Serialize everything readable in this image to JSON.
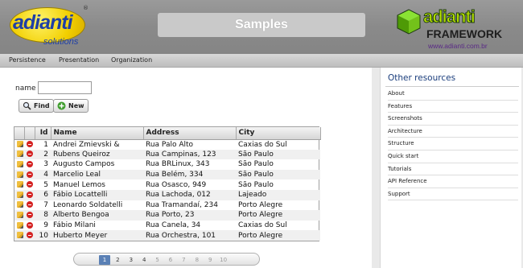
{
  "header": {
    "logo_left": {
      "word": "adianti",
      "sub": "solutions",
      "reg": "®"
    },
    "title": "Samples",
    "logo_right": {
      "word": "adianti",
      "sub": "FRAMEWORK",
      "url": "www.adianti.com.br"
    }
  },
  "menu": {
    "items": [
      "Persistence",
      "Presentation",
      "Organization"
    ]
  },
  "form": {
    "name_label": "name",
    "name_value": "",
    "find_label": "Find",
    "new_label": "New"
  },
  "grid": {
    "columns": [
      "Id",
      "Name",
      "Address",
      "City"
    ],
    "rows": [
      {
        "id": "1",
        "name": "Andrei Zmievski &",
        "address": "Rua Palo Alto",
        "city": "Caxias do Sul"
      },
      {
        "id": "2",
        "name": "Rubens Queiroz",
        "address": "Rua Campinas, 123",
        "city": "São Paulo"
      },
      {
        "id": "3",
        "name": "Augusto Campos",
        "address": "Rua BRLinux, 343",
        "city": "São Paulo"
      },
      {
        "id": "4",
        "name": "Marcelio Leal",
        "address": "Rua Belém, 334",
        "city": "São Paulo"
      },
      {
        "id": "5",
        "name": "Manuel Lemos",
        "address": "Rua Osasco, 949",
        "city": "São Paulo"
      },
      {
        "id": "6",
        "name": "Fábio Locattelli",
        "address": "Rua Lachoda, 012",
        "city": "Lajeado"
      },
      {
        "id": "7",
        "name": "Leonardo Soldatelli",
        "address": "Rua Tramandaí, 234",
        "city": "Porto Alegre"
      },
      {
        "id": "8",
        "name": "Alberto Bengoa",
        "address": "Rua Porto, 23",
        "city": "Porto Alegre"
      },
      {
        "id": "9",
        "name": "Fábio Milani",
        "address": "Rua Canela, 34",
        "city": "Caxias do Sul"
      },
      {
        "id": "10",
        "name": "Huberto Meyer",
        "address": "Rua Orchestra, 101",
        "city": "Porto Alegre"
      }
    ]
  },
  "pagination": {
    "pages": [
      "1",
      "2",
      "3",
      "4",
      "5",
      "6",
      "7",
      "8",
      "9",
      "10"
    ],
    "active": "1"
  },
  "sidebar": {
    "title": "Other resources",
    "items": [
      "About",
      "Features",
      "Screenshots",
      "Architecture",
      "Structure",
      "Quick start",
      "Tutorials",
      "API Reference",
      "Support"
    ]
  },
  "colors": {
    "header_bg": "#8a8a8a",
    "sidebar_title": "#1a3d7c",
    "active_page": "#5a80b5",
    "delete_icon": "#d42222"
  }
}
